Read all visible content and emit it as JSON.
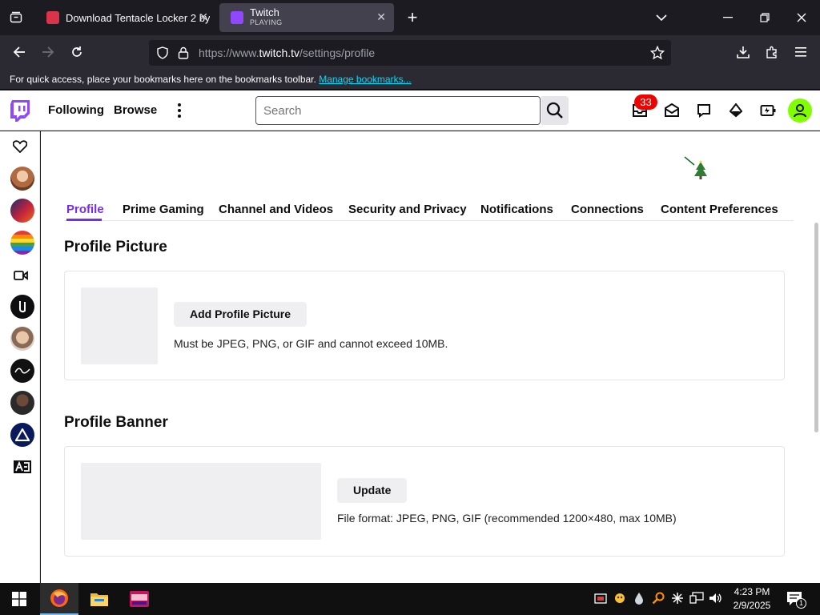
{
  "browser": {
    "tabs": [
      {
        "title": "Download Tentacle Locker 2 by",
        "active": false,
        "favicon_color": "#d9344a"
      },
      {
        "title": "Twitch",
        "subtitle": "PLAYING",
        "active": true,
        "favicon_color": "#9146ff"
      }
    ],
    "url_prefix": "https://www.",
    "url_domain": "twitch.tv",
    "url_path": "/settings/profile",
    "bookmarks_text": "For quick access, place your bookmarks here on the bookmarks toolbar.",
    "bookmarks_link": "Manage bookmarks..."
  },
  "twitch": {
    "nav": {
      "following": "Following",
      "browse": "Browse"
    },
    "search_placeholder": "Search",
    "notification_count": "33",
    "brand_color": "#9146ff",
    "avatar_color": "#7fff00",
    "settings_tabs": [
      "Profile",
      "Prime Gaming",
      "Channel and Videos",
      "Security and Privacy",
      "Notifications",
      "Connections",
      "Content Preferences"
    ],
    "active_tab": "Profile",
    "profile_picture": {
      "title": "Profile Picture",
      "button": "Add Profile Picture",
      "helper": "Must be JPEG, PNG, or GIF and cannot exceed 10MB."
    },
    "profile_banner": {
      "title": "Profile Banner",
      "button": "Update",
      "helper": "File format: JPEG, PNG, GIF (recommended 1200×480, max 10MB)"
    }
  },
  "taskbar": {
    "time": "4:23 PM",
    "date": "2/9/2025",
    "notification_count": "1"
  }
}
